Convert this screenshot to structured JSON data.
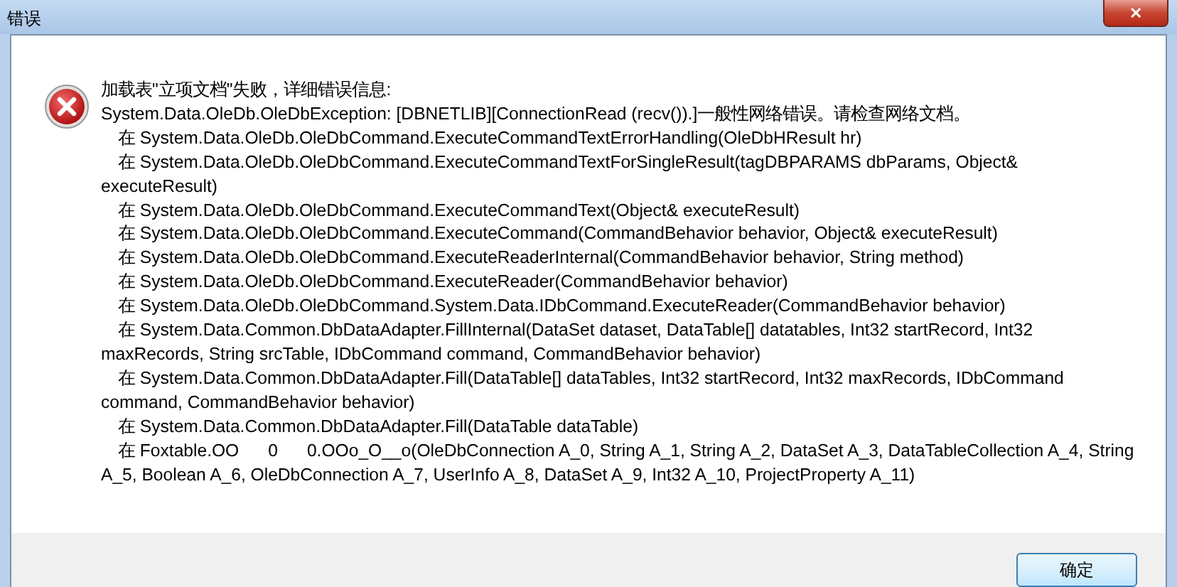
{
  "window": {
    "title": "错误",
    "close_label": "✕"
  },
  "message": {
    "heading": "加载表\"立项文档\"失败，详细错误信息:",
    "exception": "System.Data.OleDb.OleDbException: [DBNETLIB][ConnectionRead (recv()).]一般性网络错误。请检查网络文档。",
    "frames": [
      "在 System.Data.OleDb.OleDbCommand.ExecuteCommandTextErrorHandling(OleDbHResult hr)",
      "在 System.Data.OleDb.OleDbCommand.ExecuteCommandTextForSingleResult(tagDBPARAMS dbParams, Object& executeResult)",
      "在 System.Data.OleDb.OleDbCommand.ExecuteCommandText(Object& executeResult)",
      "在 System.Data.OleDb.OleDbCommand.ExecuteCommand(CommandBehavior behavior, Object& executeResult)",
      "在 System.Data.OleDb.OleDbCommand.ExecuteReaderInternal(CommandBehavior behavior, String method)",
      "在 System.Data.OleDb.OleDbCommand.ExecuteReader(CommandBehavior behavior)",
      "在 System.Data.OleDb.OleDbCommand.System.Data.IDbCommand.ExecuteReader(CommandBehavior behavior)",
      "在 System.Data.Common.DbDataAdapter.FillInternal(DataSet dataset, DataTable[] datatables, Int32 startRecord, Int32 maxRecords, String srcTable, IDbCommand command, CommandBehavior behavior)",
      "在 System.Data.Common.DbDataAdapter.Fill(DataTable[] dataTables, Int32 startRecord, Int32 maxRecords, IDbCommand command, CommandBehavior behavior)",
      "在 System.Data.Common.DbDataAdapter.Fill(DataTable dataTable)",
      "在 Foxtable.OO      0      0.OOo_O__o(OleDbConnection A_0, String A_1, String A_2, DataSet A_3, DataTableCollection A_4, String A_5, Boolean A_6, OleDbConnection A_7, UserInfo A_8, DataSet A_9, Int32 A_10, ProjectProperty A_11)"
    ]
  },
  "buttons": [
    "确定"
  ]
}
